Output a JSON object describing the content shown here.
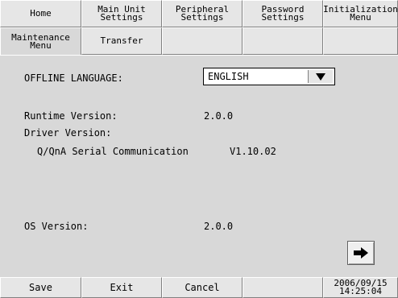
{
  "tabs_row1": [
    "Home",
    "Main Unit\nSettings",
    "Peripheral\nSettings",
    "Password\nSettings",
    "Initialization\nMenu"
  ],
  "tabs_row2": [
    "Maintenance\nMenu",
    "Transfer",
    "",
    "",
    ""
  ],
  "main": {
    "offline_language_label": "OFFLINE LANGUAGE:",
    "offline_language_value": "ENGLISH",
    "runtime_version_label": "Runtime Version:",
    "runtime_version_value": "2.0.0",
    "driver_version_label": "Driver Version:",
    "driver_name": "Q/QnA Serial Communication",
    "driver_version_value": "V1.10.02",
    "os_version_label": "OS Version:",
    "os_version_value": "2.0.0"
  },
  "bottom": {
    "save_label": "Save",
    "exit_label": "Exit",
    "cancel_label": "Cancel",
    "date": "2006/09/15",
    "time": "14:25:04"
  },
  "icons": {
    "dropdown": "triangle-down-icon",
    "next": "arrow-right-icon"
  }
}
